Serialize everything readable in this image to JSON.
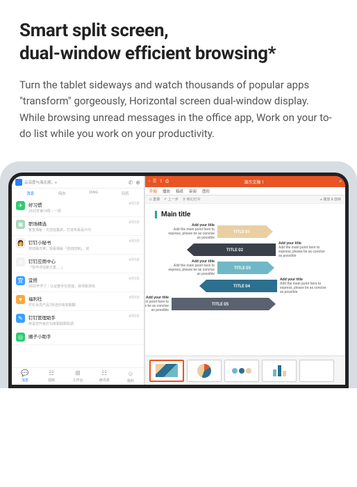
{
  "heading": "Smart split screen,\ndual-window efficient browsing*",
  "description": "Turn the tablet sideways and watch thousands of popular apps \"transform\" gorgeously, Horizontal screen dual-window display. While browsing unread messages in the office app, Work on your to-do list while you work on your productivity.",
  "left": {
    "headerText": "云深度与海无境。+",
    "tabs": [
      "消息",
      "待办",
      "DING",
      "日历"
    ],
    "items": [
      {
        "color": "#2ecc71",
        "icon": "✈",
        "name": "好习惯",
        "sub": "2022年第14周｜一周",
        "date": "4月5日"
      },
      {
        "color": "#a8d8b9",
        "icon": "▣",
        "name": "职场精选",
        "sub": "官宣揭秘｜文创征集启，打造专属设计内",
        "date": "4月5日"
      },
      {
        "color": "#ffffff",
        "icon": "👩",
        "name": "钉钉小秘书",
        "sub": "劳动最光荣，观看揭秘「自动控制」，动",
        "date": "4月5日"
      },
      {
        "color": "#f0f0f0",
        "icon": "⊞",
        "name": "钉钉应用中心",
        "sub": "「协作评估新方案……」",
        "date": "4月5日"
      },
      {
        "color": "#3aa0ff",
        "icon": "宜",
        "name": "宜搭",
        "sub": "2022开学了｜认证数字化技能，助你职场有",
        "date": "4月5日"
      },
      {
        "color": "#ffa53a",
        "icon": "♥",
        "name": "福利社",
        "sub": "钉钉会员产品7折送你有效期翻",
        "date": "4月5日"
      },
      {
        "color": "#3aa0ff",
        "icon": "✎",
        "name": "钉钉管理助手",
        "sub": "恭喜您升级打勾考勤取数助调",
        "date": "4月5日"
      },
      {
        "color": "#2ecc71",
        "icon": "◎",
        "name": "圈子小助手",
        "sub": "",
        "date": ""
      }
    ],
    "nav": [
      "消息",
      "视频",
      "工作台",
      "通讯录",
      "我的"
    ]
  },
  "right": {
    "docTitle": "演示文稿 1",
    "menu": [
      "开始",
      "播放",
      "稿纸",
      "审阅",
      "图形"
    ],
    "toolbar": [
      "重做",
      "上一步",
      "新幻灯片"
    ],
    "toolbarRight": "播放 & 放映",
    "slide": {
      "mainTitle": "Main title",
      "addTitle": "Add your title",
      "addSub": "Add the main point here to express, please be as concise as possible",
      "arrows": [
        {
          "label": "TITLE 01",
          "color": "#e9cfa3"
        },
        {
          "label": "TITLE 02",
          "color": "#3a3f4a"
        },
        {
          "label": "TITLE 03",
          "color": "#70b8c7"
        },
        {
          "label": "TITLE 04",
          "color": "#2c6f8e"
        },
        {
          "label": "TITLE 05",
          "color": "#5a6270"
        }
      ]
    }
  }
}
